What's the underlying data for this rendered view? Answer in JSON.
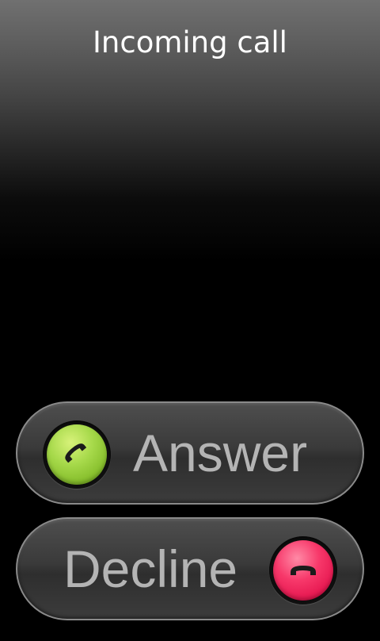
{
  "header": {
    "title": "Incoming call"
  },
  "actions": {
    "answer": {
      "label": "Answer",
      "icon": "phone-answer-icon",
      "color": "#8cc832"
    },
    "decline": {
      "label": "Decline",
      "icon": "phone-hangup-icon",
      "color": "#f0285a"
    }
  }
}
